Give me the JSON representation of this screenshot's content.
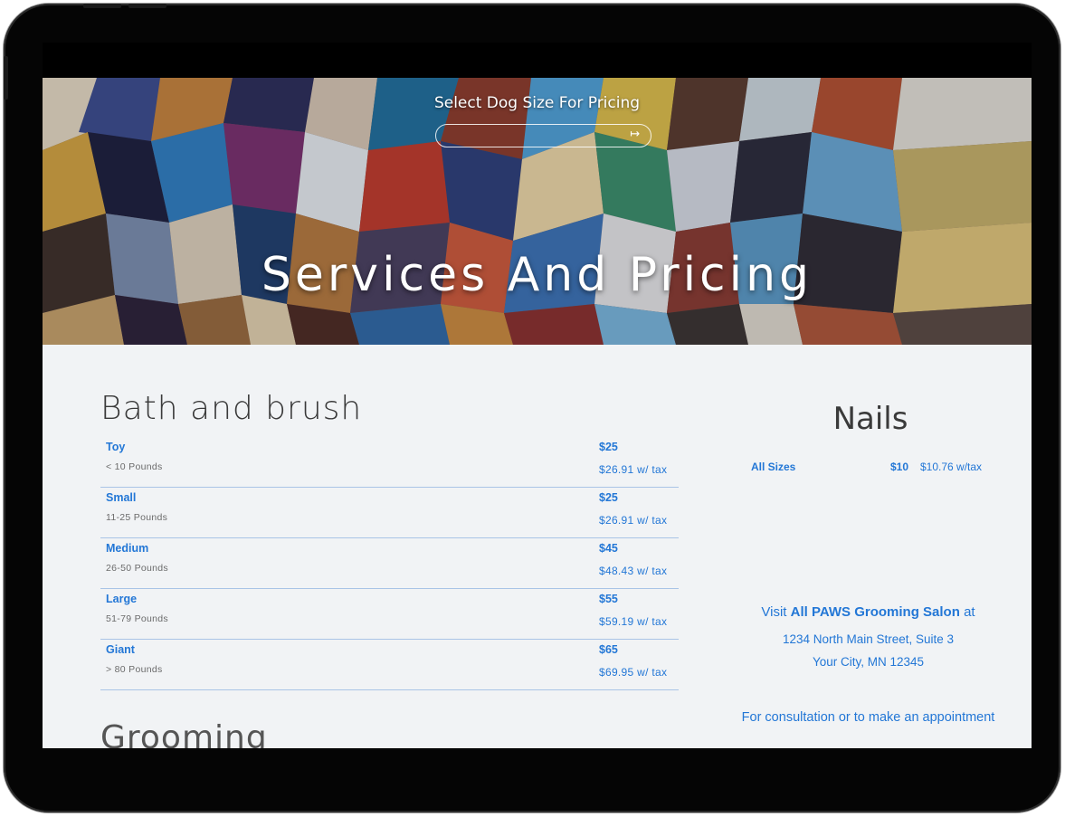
{
  "hero": {
    "select_label": "Select Dog Size For Pricing",
    "select_arrow_icon": "arrow-to-right-icon",
    "title": "Services And Pricing"
  },
  "bath": {
    "title": "Bath and brush",
    "rows": [
      {
        "size": "Toy",
        "weight": "< 10 Pounds",
        "price": "$25",
        "tax": "$26.91 w/ tax"
      },
      {
        "size": "Small",
        "weight": "11-25 Pounds",
        "price": "$25",
        "tax": "$26.91 w/ tax"
      },
      {
        "size": "Medium",
        "weight": "26-50 Pounds",
        "price": "$45",
        "tax": "$48.43 w/ tax"
      },
      {
        "size": "Large",
        "weight": "51-79 Pounds",
        "price": "$55",
        "tax": "$59.19 w/ tax"
      },
      {
        "size": "Giant",
        "weight": "> 80 Pounds",
        "price": "$65",
        "tax": "$69.95 w/ tax"
      }
    ]
  },
  "grooming": {
    "title": "Grooming"
  },
  "nails": {
    "title": "Nails",
    "size": "All Sizes",
    "price": "$10",
    "tax": "$10.76 w/tax"
  },
  "visit": {
    "prefix": "Visit",
    "name": "All PAWS Grooming Salon",
    "suffix": "at",
    "address1": "1234 North Main Street, Suite 3",
    "address2": "Your City, MN 12345",
    "consult": "For consultation or to make an appointment"
  },
  "colors": {
    "accent": "#2377d6",
    "content_bg": "#f1f3f5",
    "divider": "#a9c4e6"
  }
}
